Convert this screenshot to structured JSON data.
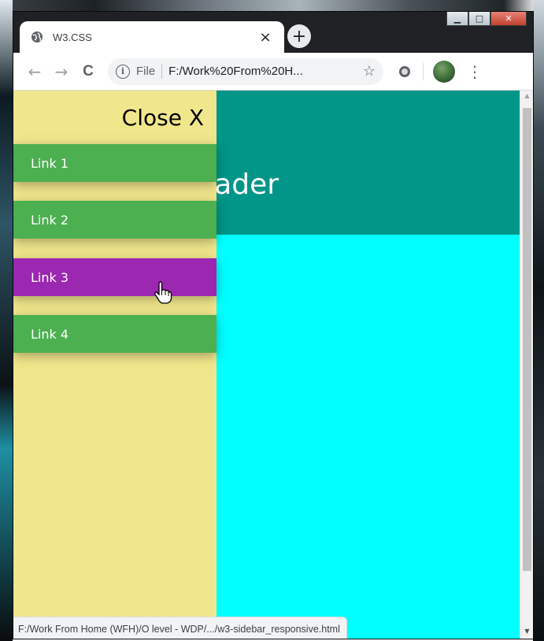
{
  "browser": {
    "tab": {
      "title": "W3.CSS",
      "favicon": "globe-icon",
      "close_glyph": "×"
    },
    "new_tab_glyph": "+",
    "caption": {
      "minimize_glyph": "▁",
      "maximize_glyph": "□",
      "close_glyph": "✕"
    },
    "toolbar": {
      "back_glyph": "←",
      "forward_glyph": "→",
      "reload_glyph": "C",
      "info_glyph": "i",
      "file_label": "File",
      "url": "F:/Work%20From%20H...",
      "star_glyph": "☆",
      "menu_glyph": "⋮"
    },
    "status_url": "F:/Work From Home (WFH)/O level - WDP/.../w3-sidebar_responsive.html"
  },
  "page": {
    "header_text": "Header",
    "sidebar": {
      "close_label": "Close X",
      "links": [
        {
          "label": "Link 1",
          "state": "normal"
        },
        {
          "label": "Link 2",
          "state": "normal"
        },
        {
          "label": "Link 3",
          "state": "hover"
        },
        {
          "label": "Link 4",
          "state": "normal"
        }
      ]
    },
    "colors": {
      "sidebar_bg": "#f0e68c",
      "link_bg": "#4caf50",
      "link_hover_bg": "#9c27b0",
      "header_bg": "#009688",
      "page_bg": "#00ffff"
    }
  }
}
